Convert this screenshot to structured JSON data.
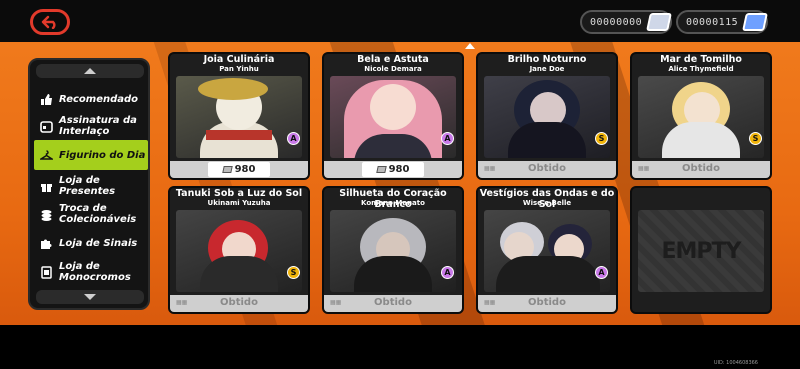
{
  "header": {
    "back_icon": "back-arrow-icon",
    "currencies": [
      {
        "value": "00000000",
        "icon": "film-ticket-icon"
      },
      {
        "value": "00000115",
        "icon": "blue-ticket-icon"
      }
    ]
  },
  "sidebar": {
    "items": [
      {
        "label": "Recomendado",
        "icon": "thumbs-up-icon",
        "active": false
      },
      {
        "label": "Assinatura da Interlaço",
        "icon": "calendar-icon",
        "active": false
      },
      {
        "label": "Figurino do Dia",
        "icon": "hanger-icon",
        "active": true
      },
      {
        "label": "Loja de Presentes",
        "icon": "gift-icon",
        "active": false
      },
      {
        "label": "Troca de Colecionáveis",
        "icon": "coins-icon",
        "active": false
      },
      {
        "label": "Loja de Sinais",
        "icon": "puzzle-icon",
        "active": false
      },
      {
        "label": "Loja de Monocromos",
        "icon": "film-icon",
        "active": false
      }
    ]
  },
  "cards": [
    {
      "title": "Joia Culinária",
      "sub": "Pan Yinhu",
      "rank": "A",
      "price": "980",
      "status": ""
    },
    {
      "title": "Bela e Astuta",
      "sub": "Nicole Demara",
      "rank": "A",
      "price": "980",
      "status": ""
    },
    {
      "title": "Brilho Noturno",
      "sub": "Jane Doe",
      "rank": "S",
      "price": "",
      "status": "Obtido"
    },
    {
      "title": "Mar de Tomilho",
      "sub": "Alice Thymefield",
      "rank": "S",
      "price": "",
      "status": "Obtido"
    },
    {
      "title": "Tanuki Sob a Luz do Sol",
      "sub": "Ukinami Yuzuha",
      "rank": "S",
      "price": "",
      "status": "Obtido"
    },
    {
      "title": "Silhueta do Coração Branco",
      "sub": "Komano Manato",
      "rank": "A",
      "price": "",
      "status": "Obtido"
    },
    {
      "title": "Vestígios das Ondas e do Sol",
      "sub": "Wise e Belle",
      "rank": "A",
      "price": "",
      "status": "Obtido"
    },
    {
      "title": "",
      "sub": "",
      "rank": "",
      "price": "",
      "status": "",
      "empty_label": "EMPTY"
    }
  ],
  "uid": "UID: 1004608366"
}
